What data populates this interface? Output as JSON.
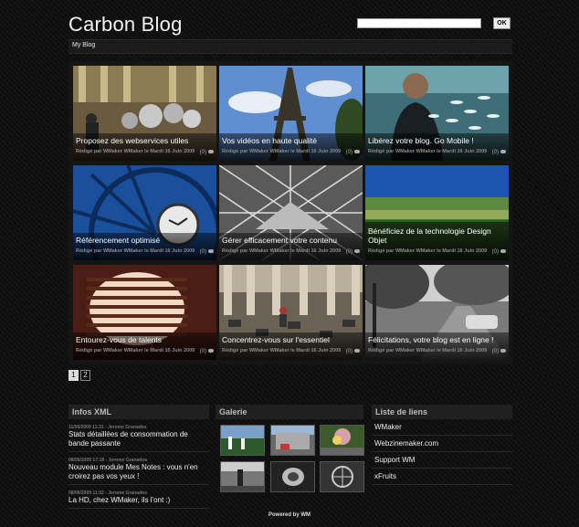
{
  "header": {
    "title": "Carbon Blog",
    "search_button": "OK",
    "search_value": ""
  },
  "nav": {
    "items": [
      "My Blog"
    ]
  },
  "posts": [
    {
      "title": "Proposez des webservices utiles",
      "meta": "Rédigé par WMaker WMaker le Mardi 16 Juin 2009",
      "comments": "(0)",
      "image": "silver-spheres-photo"
    },
    {
      "title": "Vos vidéos en haute qualité",
      "meta": "Rédigé par WMaker WMaker le Mardi 16 Juin 2009",
      "comments": "(0)",
      "image": "eiffel-tower-photo"
    },
    {
      "title": "Libérez votre blog. Go Mobile !",
      "meta": "Rédigé par WMaker WMaker le Mardi 16 Juin 2009",
      "comments": "(0)",
      "image": "person-with-fish-photo"
    },
    {
      "title": "Référencement optimisé",
      "meta": "Rédigé par WMaker WMaker le Mardi 16 Juin 2009",
      "comments": "(0)",
      "image": "clock-window-photo"
    },
    {
      "title": "Gérer efficacement votre contenu",
      "meta": "Rédigé par WMaker WMaker le Mardi 16 Juin 2009",
      "comments": "(0)",
      "image": "glass-pyramid-photo"
    },
    {
      "title": "Bénéficiez de la technologie Design Objet",
      "meta": "Rédigé par WMaker WMaker le Mardi 16 Juin 2009",
      "comments": "(0)",
      "image": "landscape-photo"
    },
    {
      "title": "Entourez-vous de talents",
      "meta": "Rédigé par WMaker WMaker le Mardi 16 Juin 2009",
      "comments": "(0)",
      "image": "striped-lamp-photo"
    },
    {
      "title": "Concentrez-vous sur l'essentiel",
      "meta": "Rédigé par WMaker WMaker le Mardi 16 Juin 2009",
      "comments": "(0)",
      "image": "columns-photo"
    },
    {
      "title": "Félicitations, votre blog est en ligne !",
      "meta": "Rédigé par WMaker WMaker le Mardi 16 Juin 2009",
      "comments": "(0)",
      "image": "street-photo"
    }
  ],
  "pagination": {
    "pages": [
      "1",
      "2"
    ],
    "current": "1"
  },
  "infos": {
    "title": "Infos XML",
    "items": [
      {
        "date": "11/06/2009 11:31 - Jerome Granados",
        "title": "Stats détaillées de consommation de bande passante"
      },
      {
        "date": "08/06/2009 17:18 - Jerome Granados",
        "title": "Nouveau module Mes Notes : vous n'en croirez pas vos yeux !"
      },
      {
        "date": "08/06/2009 11:02 - Jerome Granados",
        "title": "La HD, chez WMaker, ils l'ont :)"
      }
    ]
  },
  "gallery": {
    "title": "Galerie"
  },
  "links": {
    "title": "Liste de liens",
    "items": [
      "WMaker",
      "Webzinemaker.com",
      "Support WM",
      "xFruits"
    ]
  },
  "footer": {
    "text": "Powered by WM"
  }
}
